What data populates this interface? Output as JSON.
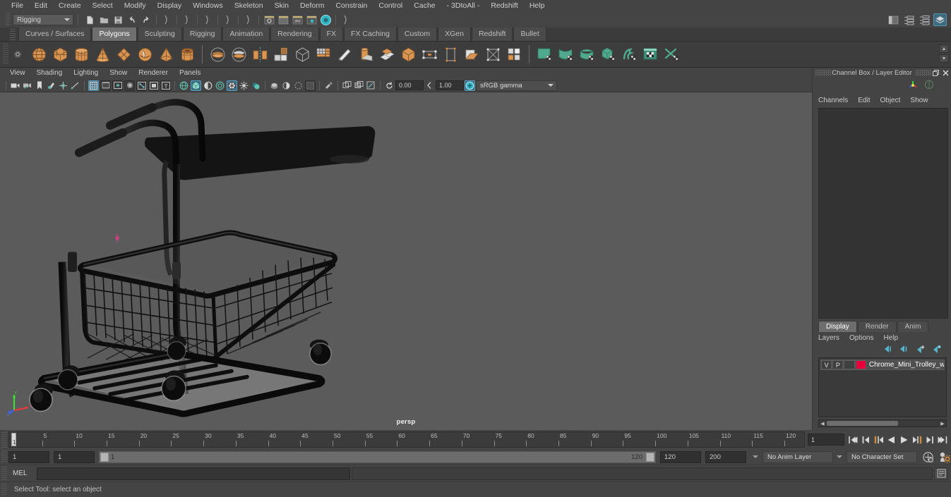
{
  "menubar": {
    "items": [
      "File",
      "Edit",
      "Create",
      "Select",
      "Modify",
      "Display",
      "Windows",
      "Skeleton",
      "Skin",
      "Deform",
      "Constrain",
      "Control",
      "Cache",
      "- 3DtoAll -",
      "Redshift",
      "Help"
    ]
  },
  "statusline": {
    "menu_set": "Rigging",
    "icons": [
      "new-scene-icon",
      "open-scene-icon",
      "save-scene-icon",
      "undo-icon",
      "redo-icon",
      "select-by-hierarchy-icon",
      "select-by-object-icon",
      "select-by-component-icon",
      "snap-grid-icon",
      "snap-curve-icon",
      "snap-point-icon",
      "snap-view-plane-icon",
      "render-current-frame-icon",
      "ipr-render-icon",
      "render-settings-icon",
      "hypershade-icon",
      "render-view-icon"
    ],
    "right_icons": [
      "sidebar-toggle-icon",
      "attribute-editor-icon",
      "tool-settings-icon",
      "channel-box-icon"
    ]
  },
  "shelf": {
    "tabs": [
      "Curves / Surfaces",
      "Polygons",
      "Sculpting",
      "Rigging",
      "Animation",
      "Rendering",
      "FX",
      "FX Caching",
      "Custom",
      "XGen",
      "Redshift",
      "Bullet"
    ],
    "active_tab": "Polygons",
    "group1": [
      "poly-sphere-icon",
      "poly-cube-icon",
      "poly-cylinder-icon",
      "poly-cone-icon",
      "poly-plane-icon",
      "poly-torus-icon",
      "poly-pyramid-icon",
      "poly-pipe-icon"
    ],
    "group2": [
      "poly-booleans-union-icon",
      "poly-combine-icon",
      "poly-mirror-icon",
      "poly-smooth-icon",
      "poly-extract-icon",
      "poly-quadrangulate-icon",
      "poly-sculpt-icon",
      "poly-cylinder-stack-icon",
      "poly-multi-cut-icon",
      "poly-bevel-icon",
      "poly-bridge-icon",
      "poly-append-icon",
      "poly-wedge-icon",
      "poly-crease-icon",
      "poly-target-weld-icon"
    ],
    "group3": [
      "uv-planar-icon",
      "uv-cylindrical-icon",
      "uv-spherical-icon",
      "uv-automatic-icon",
      "uv-unfold-icon",
      "uv-editor-icon",
      "uv-cut-sew-icon"
    ],
    "scroll_up": "▲",
    "scroll_down": "▼"
  },
  "viewport": {
    "menus": [
      "View",
      "Shading",
      "Lighting",
      "Show",
      "Renderer",
      "Panels"
    ],
    "toolbar_icons": [
      "select-camera-icon",
      "lock-camera-icon",
      "bookmark-icon",
      "image-plane-icon",
      "resolution-gate-icon",
      "gate-mask-icon",
      "grid-toggle-icon",
      "film-gate-icon",
      "resolution-gate2-icon",
      "2d-pan-zoom-icon",
      "exposure-icon",
      "frame-icon",
      "text-icon",
      "wireframe-icon",
      "smooth-shade-icon",
      "shaded-wireframe-icon",
      "hardware-texture-icon",
      "xray-icon",
      "lighting-icon",
      "shadows-icon",
      "occlusion-icon",
      "aa-icon",
      "motionblur-icon",
      "multisample-icon",
      "isolate-select-icon",
      "gpu-cache-icon",
      "viewport-snapshot-icon",
      "grid-snap-icon"
    ],
    "exposure_value": "0.00",
    "gamma_value": "1.00",
    "color_profile": "sRGB gamma",
    "camera_label": "persp"
  },
  "channel_box": {
    "title": "Channel Box / Layer Editor",
    "menus": [
      "Channels",
      "Edit",
      "Object",
      "Show"
    ],
    "undock_icon": "undock-icon",
    "close_icon": "close-icon"
  },
  "layer_editor": {
    "tabs": [
      "Display",
      "Render",
      "Anim"
    ],
    "active_tab": "Display",
    "menus": [
      "Layers",
      "Options",
      "Help"
    ],
    "buttons": [
      "move-layer-up-icon",
      "move-layer-down-icon",
      "new-layer-icon",
      "new-layer-from-selected-icon"
    ],
    "columns": [
      "V",
      "P"
    ],
    "layers": [
      {
        "visible": "V",
        "playback": "P",
        "color": "#e8003c",
        "name": "Chrome_Mini_Trolley_wit"
      }
    ]
  },
  "timeslider": {
    "start": 1,
    "end": 120,
    "tick_labels": [
      5,
      10,
      15,
      20,
      25,
      30,
      35,
      40,
      45,
      50,
      55,
      60,
      65,
      70,
      75,
      80,
      85,
      90,
      95,
      100,
      105,
      110,
      115,
      120
    ],
    "current_frame": "1",
    "current_frame_field": "1",
    "playback_buttons": [
      "go-to-start-icon",
      "step-back-key-icon",
      "step-back-frame-icon",
      "play-backwards-icon",
      "play-forwards-icon",
      "step-forward-frame-icon",
      "step-forward-key-icon",
      "go-to-end-icon"
    ]
  },
  "range_slider": {
    "anim_start": "1",
    "range_start": "1",
    "bar_start": "1",
    "bar_end": "120",
    "range_end": "120",
    "anim_end": "200",
    "anim_layer": "No Anim Layer",
    "character_set": "No Character Set",
    "auto_key_icon": "auto-key-icon",
    "anim_prefs_icon": "animation-preferences-icon"
  },
  "command_line": {
    "language": "MEL",
    "input_value": "",
    "script_editor_icon": "script-editor-icon"
  },
  "help_line": {
    "text": "Select Tool: select an object"
  },
  "colors": {
    "app_bg": "#444444",
    "viewport_bg": "#5b5b5b",
    "accent_teal": "#2bb6c4",
    "highlight_blue": "#3b6f88",
    "shelf_orange": "#e0924b",
    "shelf_green": "#5aa98e",
    "layer_red": "#e8003c"
  }
}
